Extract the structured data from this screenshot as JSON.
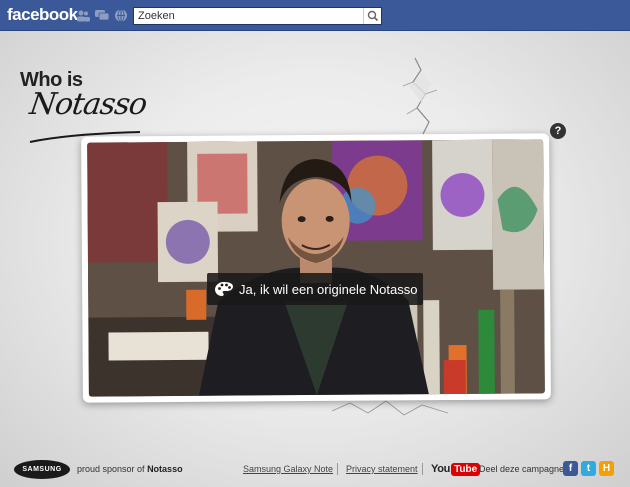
{
  "fb": {
    "logo": "facebook",
    "search_value": "Zoeken",
    "icons": [
      "friend-requests-icon",
      "messages-icon",
      "notifications-icon",
      "search-icon"
    ]
  },
  "brand": {
    "whois": "Who is",
    "name": "Notasso"
  },
  "help": {
    "label": "?"
  },
  "video": {
    "cta_label": "Ja, ik wil een originele Notasso",
    "cta_icon": "palette-icon"
  },
  "footer": {
    "samsung_logo": "SAMSUNG",
    "sponsor_prefix": "proud sponsor of",
    "sponsor_name": "Notasso",
    "links": [
      "Samsung Galaxy Note",
      "Privacy statement"
    ],
    "youtube_you": "You",
    "youtube_tube": "Tube",
    "share_label": "Deel deze campagne:",
    "share_icons": [
      {
        "name": "facebook-share-icon",
        "glyph": "f",
        "color": "#3b5998"
      },
      {
        "name": "twitter-share-icon",
        "glyph": "t",
        "color": "#33aadd"
      },
      {
        "name": "hyves-share-icon",
        "glyph": "H",
        "color": "#f5a000"
      }
    ]
  },
  "colors": {
    "fb_blue": "#3b5998",
    "cta_bg": "#191919",
    "youtube_red": "#dd0000"
  }
}
